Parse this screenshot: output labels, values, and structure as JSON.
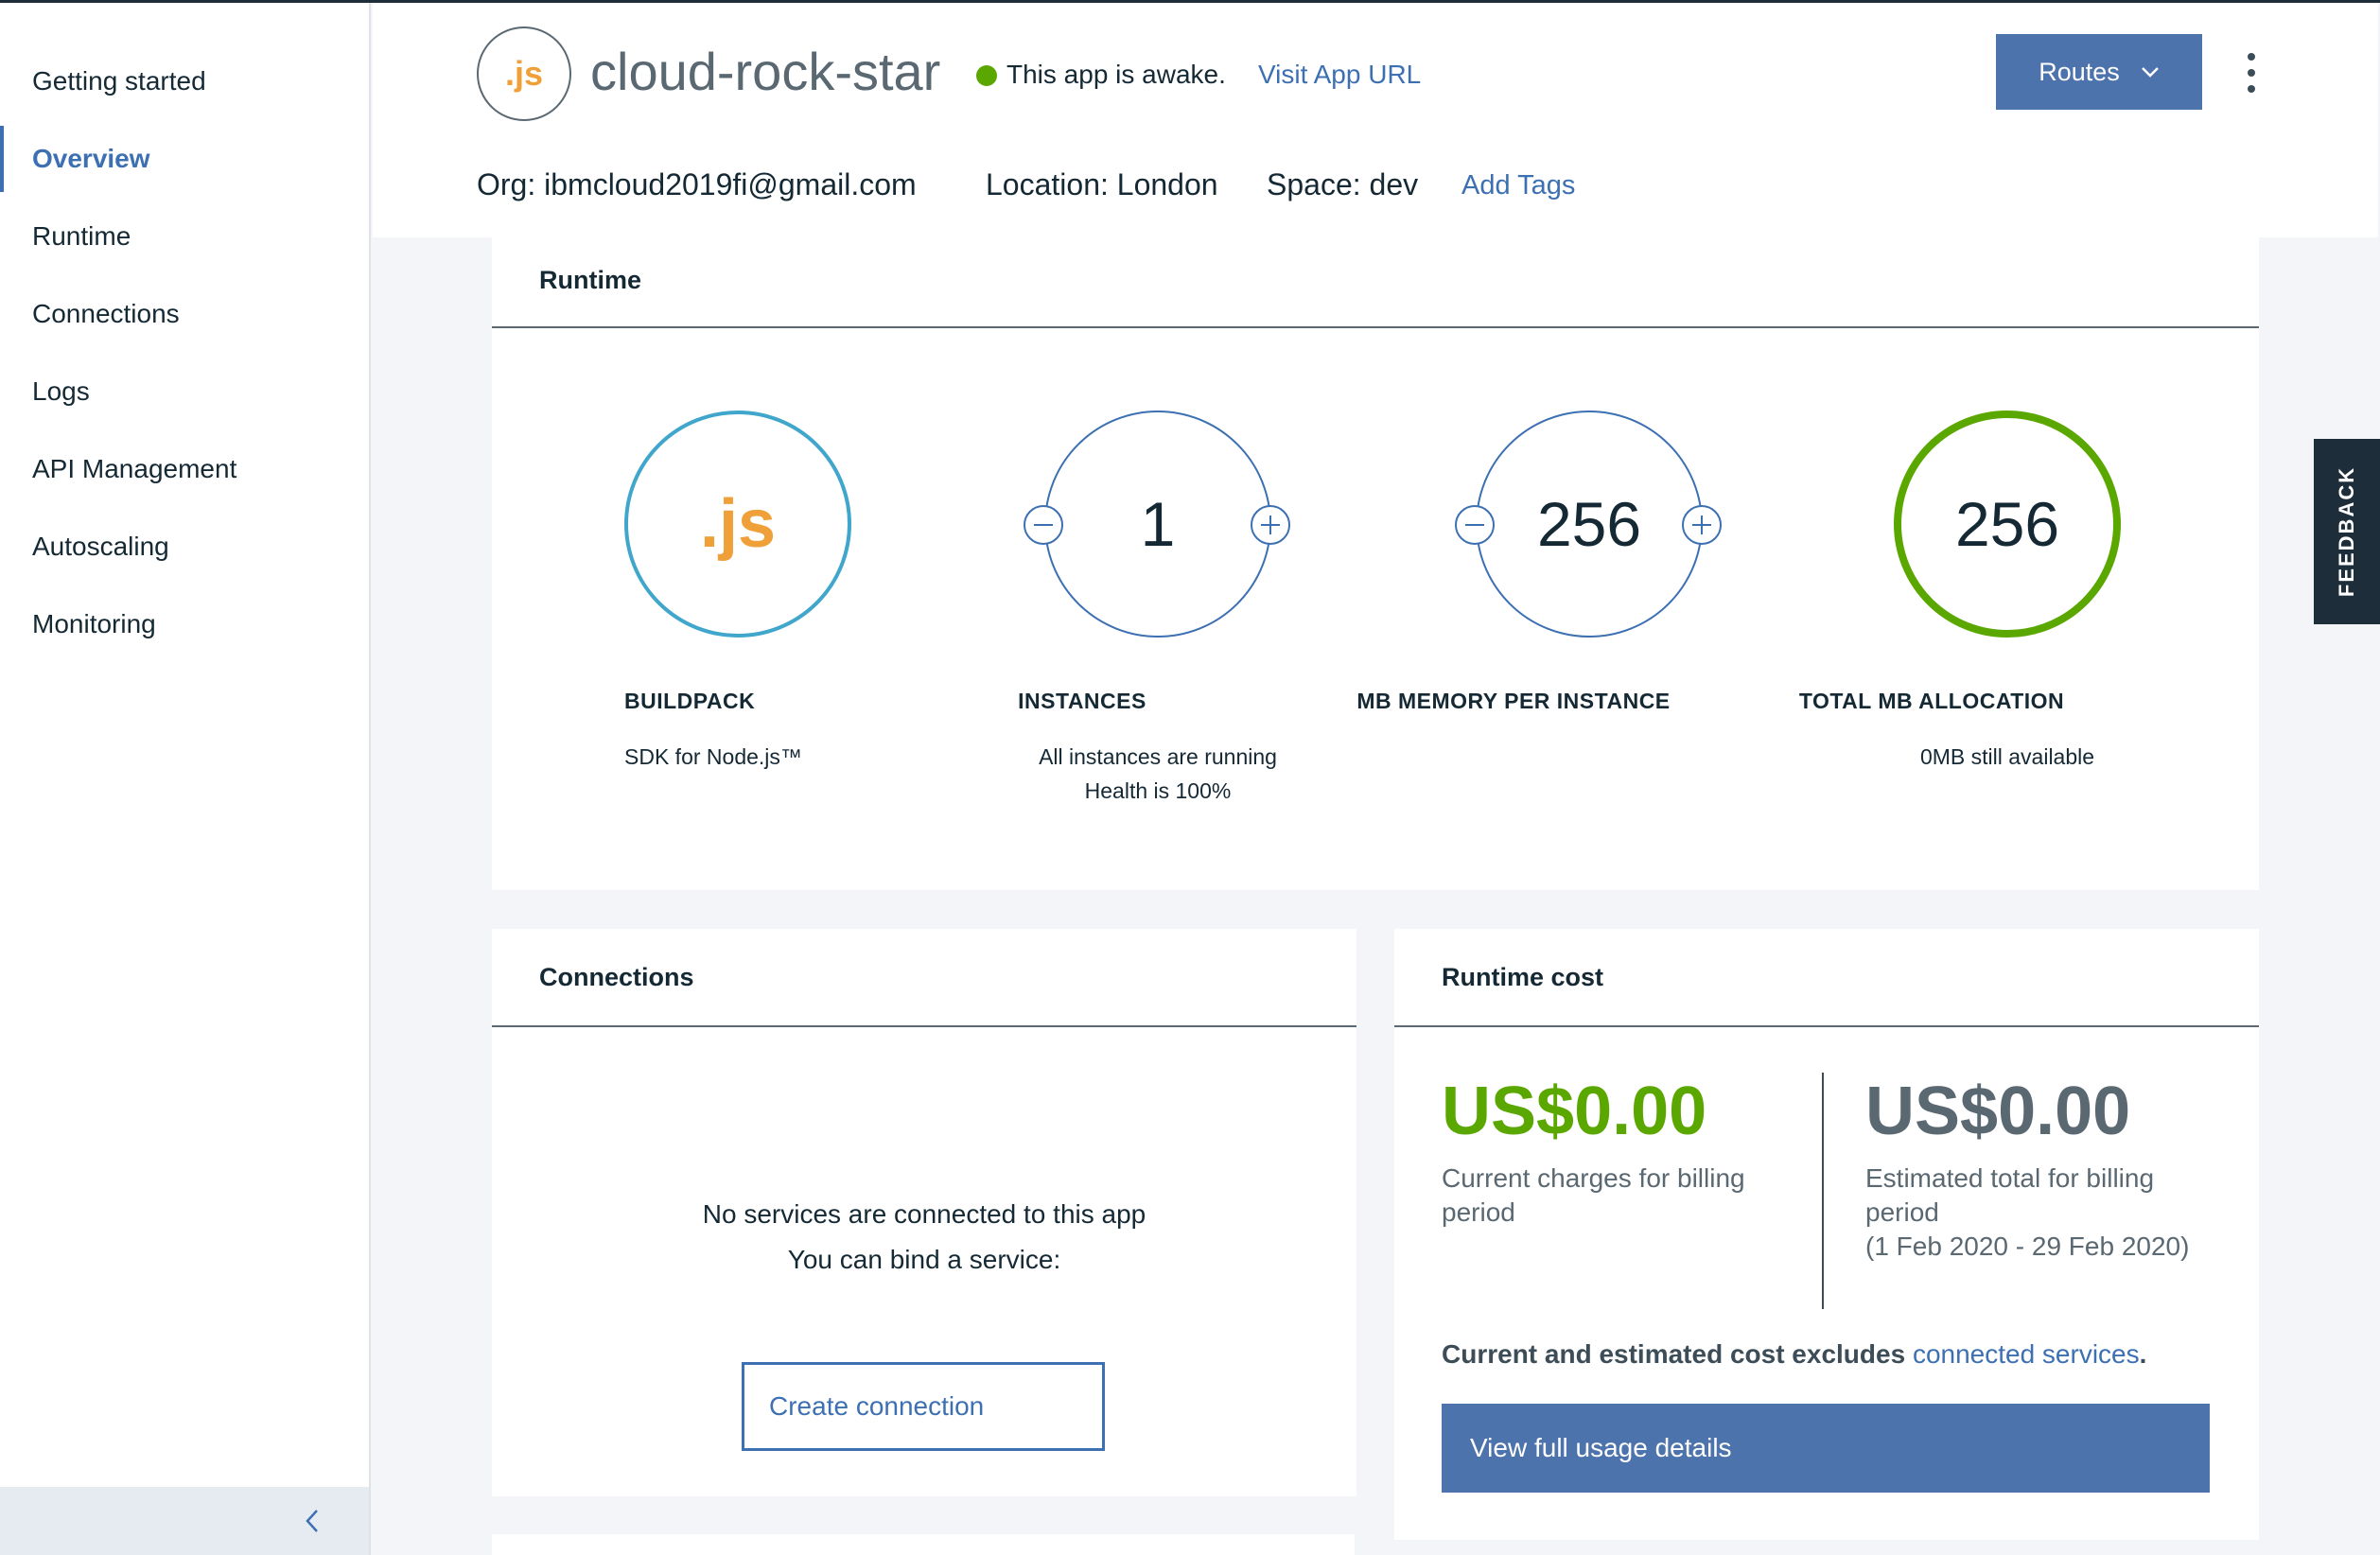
{
  "sidebar": {
    "items": [
      {
        "label": "Getting started",
        "active": false
      },
      {
        "label": "Overview",
        "active": true
      },
      {
        "label": "Runtime",
        "active": false
      },
      {
        "label": "Connections",
        "active": false
      },
      {
        "label": "Logs",
        "active": false
      },
      {
        "label": "API Management",
        "active": false
      },
      {
        "label": "Autoscaling",
        "active": false
      },
      {
        "label": "Monitoring",
        "active": false
      }
    ],
    "collapse_icon": "chevron-left-icon"
  },
  "header": {
    "app_logo_text": ".js",
    "app_name": "cloud-rock-star",
    "status_text": "This app is awake.",
    "status_color": "#5aa700",
    "visit_link": "Visit App URL",
    "routes_button": "Routes",
    "org": "Org: ibmcloud2019fi@gmail.com",
    "location": "Location: London",
    "space": "Space: dev",
    "add_tags": "Add Tags"
  },
  "runtime": {
    "title": "Runtime",
    "buildpack": {
      "logo_text": ".js",
      "label": "BUILDPACK",
      "sub": "SDK for Node.js™",
      "ring_color": "#41a6cc"
    },
    "instances": {
      "value": "1",
      "label": "INSTANCES",
      "sub_line1": "All instances are running",
      "sub_line2": "Health is 100%"
    },
    "memory": {
      "value": "256",
      "label": "MB MEMORY PER INSTANCE"
    },
    "total": {
      "value": "256",
      "label": "TOTAL MB ALLOCATION",
      "sub": "0MB still available",
      "ring_color": "#5aa700"
    }
  },
  "connections": {
    "title": "Connections",
    "empty_line1": "No services are connected to this app",
    "empty_line2": "You can bind a service:",
    "create_button": "Create connection"
  },
  "runtime_cost": {
    "title": "Runtime cost",
    "current_amount": "US$0.00",
    "current_color": "#5aa700",
    "current_desc_line1": "Current charges for billing",
    "current_desc_line2": "period",
    "estimated_amount": "US$0.00",
    "estimated_color": "#5a6872",
    "estimated_desc_line1": "Estimated total for billing",
    "estimated_desc_line2": "period",
    "estimated_desc_line3": "(1 Feb 2020 - 29 Feb 2020)",
    "note_text": "Current and estimated cost excludes ",
    "note_link": "connected services",
    "note_end": ".",
    "usage_button": "View full usage details"
  },
  "feedback": {
    "label": "FEEDBACK"
  },
  "colors": {
    "accent": "#3d70b2",
    "button": "#4d73ad",
    "text": "#152935"
  }
}
